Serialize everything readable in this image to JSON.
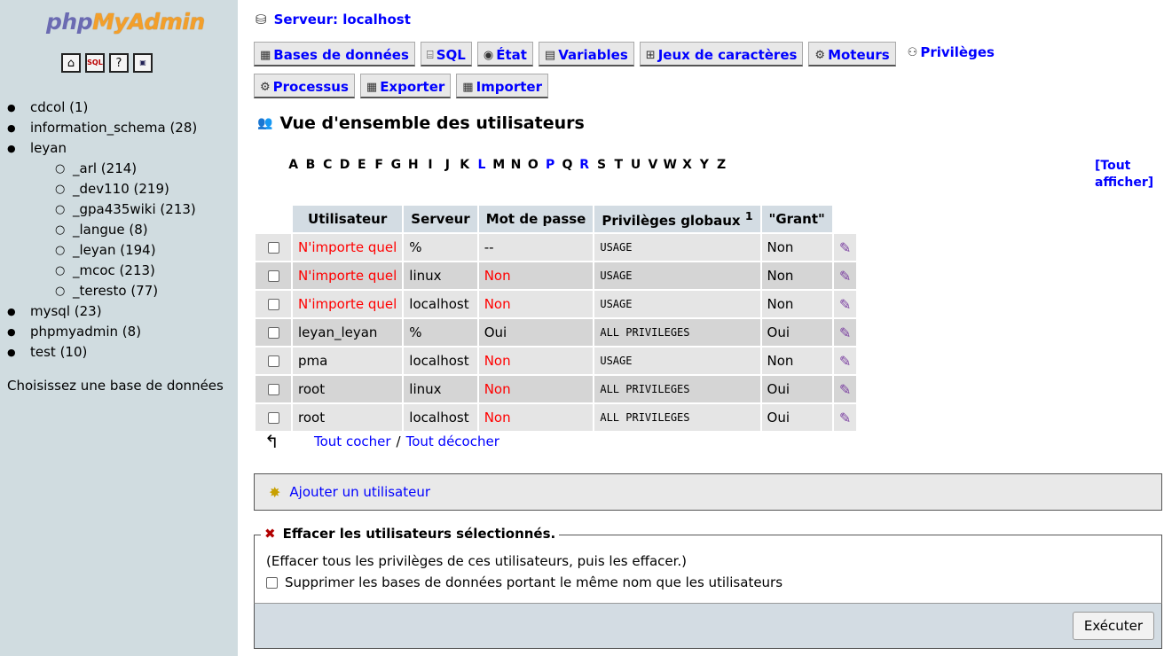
{
  "sidebar": {
    "logo": {
      "part1": "php",
      "part2": "MyAdmin"
    },
    "icons": [
      "home-icon",
      "sql-icon",
      "help-icon",
      "sql-query-window-icon"
    ],
    "databases": [
      {
        "label": "cdcol (1)"
      },
      {
        "label": "information_schema (28)"
      },
      {
        "label": "leyan",
        "children": [
          "_arl (214)",
          "_dev110 (219)",
          "_gpa435wiki (213)",
          "_langue (8)",
          "_leyan (194)",
          "_mcoc (213)",
          "_teresto (77)"
        ]
      },
      {
        "label": "mysql (23)"
      },
      {
        "label": "phpmyadmin (8)"
      },
      {
        "label": "test (10)"
      }
    ],
    "hint": "Choisissez une base de données"
  },
  "server": {
    "title": "Serveur: localhost"
  },
  "tabs": [
    {
      "label": "Bases de données",
      "icon": "databases-icon"
    },
    {
      "label": "SQL",
      "icon": "sql-icon"
    },
    {
      "label": "État",
      "icon": "status-icon"
    },
    {
      "label": "Variables",
      "icon": "variables-icon"
    },
    {
      "label": "Jeux de caractères",
      "icon": "charset-icon"
    },
    {
      "label": "Moteurs",
      "icon": "engines-icon"
    },
    {
      "label": "Privilèges",
      "icon": "privileges-icon",
      "active": true
    },
    {
      "label": "Processus",
      "icon": "process-icon"
    },
    {
      "label": "Exporter",
      "icon": "export-icon"
    },
    {
      "label": "Importer",
      "icon": "import-icon"
    }
  ],
  "heading": "Vue d'ensemble des utilisateurs",
  "alphabet": {
    "letters": [
      "A",
      "B",
      "C",
      "D",
      "E",
      "F",
      "G",
      "H",
      "I",
      "J",
      "K",
      "L",
      "M",
      "N",
      "O",
      "P",
      "Q",
      "R",
      "S",
      "T",
      "U",
      "V",
      "W",
      "X",
      "Y",
      "Z"
    ],
    "linked": [
      "L",
      "P",
      "R"
    ],
    "show_all": "[Tout afficher]"
  },
  "users_table": {
    "headers": [
      "Utilisateur",
      "Serveur",
      "Mot de passe",
      "Privilèges globaux ",
      "\"Grant\""
    ],
    "footnote_mark": "1",
    "rows": [
      {
        "user": "N'importe quel",
        "user_any": true,
        "host": "%",
        "password": "--",
        "privileges": "USAGE",
        "grant": "Non"
      },
      {
        "user": "N'importe quel",
        "user_any": true,
        "host": "linux",
        "password": "Non",
        "privileges": "USAGE",
        "grant": "Non"
      },
      {
        "user": "N'importe quel",
        "user_any": true,
        "host": "localhost",
        "password": "Non",
        "privileges": "USAGE",
        "grant": "Non"
      },
      {
        "user": "leyan_leyan",
        "user_any": false,
        "host": "%",
        "password": "Oui",
        "privileges": "ALL PRIVILEGES",
        "grant": "Oui"
      },
      {
        "user": "pma",
        "user_any": false,
        "host": "localhost",
        "password": "Non",
        "privileges": "USAGE",
        "grant": "Non"
      },
      {
        "user": "root",
        "user_any": false,
        "host": "linux",
        "password": "Non",
        "privileges": "ALL PRIVILEGES",
        "grant": "Oui"
      },
      {
        "user": "root",
        "user_any": false,
        "host": "localhost",
        "password": "Non",
        "privileges": "ALL PRIVILEGES",
        "grant": "Oui"
      }
    ]
  },
  "check_all": {
    "check": "Tout cocher",
    "separator": "/",
    "uncheck": "Tout décocher"
  },
  "add_user": "Ajouter un utilisateur",
  "delete": {
    "legend": "Effacer les utilisateurs sélectionnés.",
    "description": "(Effacer tous les privilèges de ces utilisateurs, puis les effacer.)",
    "drop_db_label": "Supprimer les bases de données portant le même nom que les utilisateurs",
    "submit": "Exécuter"
  },
  "colors": {
    "nav_bg": "#d0dce0",
    "header_bg": "#d3dce3",
    "link": "#0000ff",
    "warning_red": "#ff0000"
  }
}
